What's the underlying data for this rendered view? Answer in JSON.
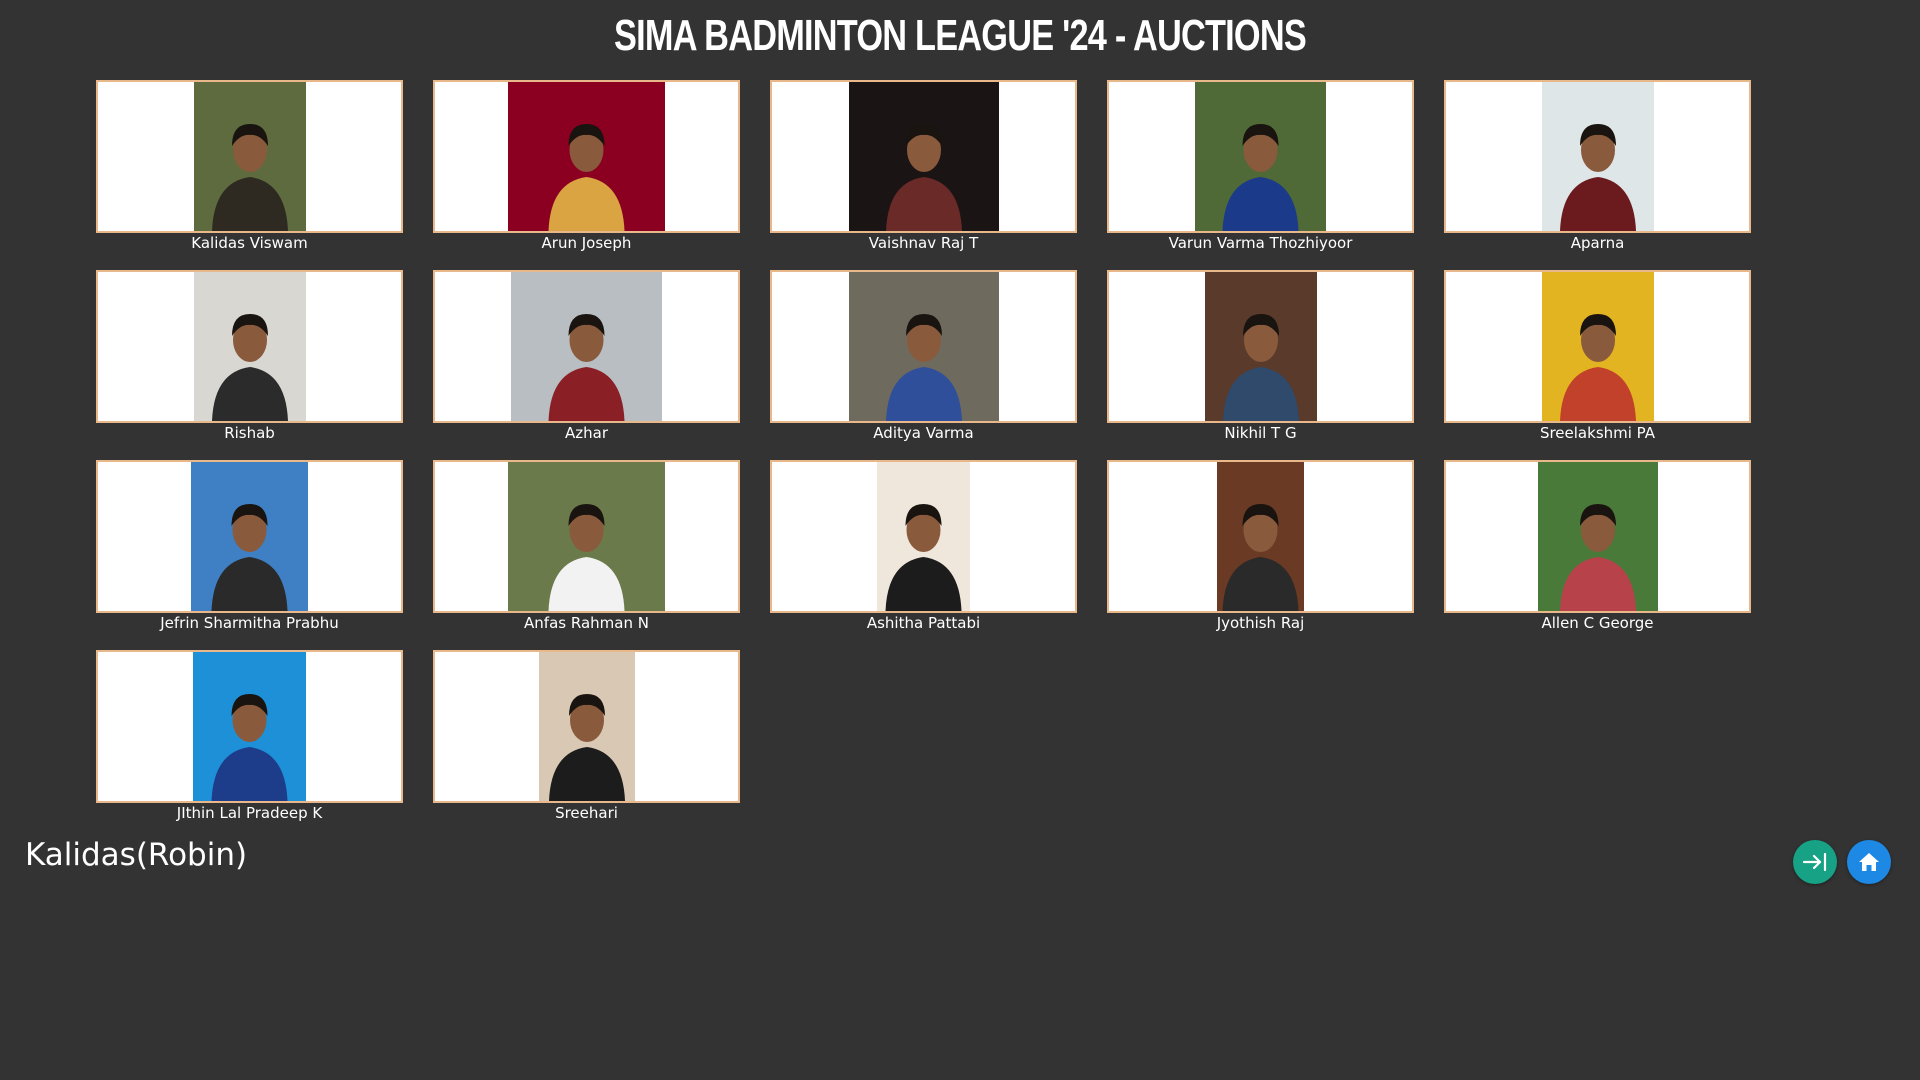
{
  "header": {
    "title": "SIMA BADMINTON LEAGUE '24 - AUCTIONS"
  },
  "players": [
    {
      "name": "Kalidas Viswam",
      "photo_bg": "#5d6b3e",
      "accent": "#2e2a22"
    },
    {
      "name": "Arun Joseph",
      "photo_bg": "#8b0020",
      "accent": "#d9a441"
    },
    {
      "name": "Vaishnav Raj T",
      "photo_bg": "#1a1414",
      "accent": "#6a2a28"
    },
    {
      "name": "Varun Varma Thozhiyoor",
      "photo_bg": "#4f6a36",
      "accent": "#1c3a8a"
    },
    {
      "name": "Aparna",
      "photo_bg": "#dfe6e8",
      "accent": "#6b1a1e"
    },
    {
      "name": "Rishab",
      "photo_bg": "#d9d7d2",
      "accent": "#2b2b2b"
    },
    {
      "name": "Azhar",
      "photo_bg": "#b8bec2",
      "accent": "#8a2026"
    },
    {
      "name": "Aditya Varma",
      "photo_bg": "#6e6a5e",
      "accent": "#2f4f9a"
    },
    {
      "name": "Nikhil T G",
      "photo_bg": "#5a3a2a",
      "accent": "#2f4a6a"
    },
    {
      "name": "Sreelakshmi PA",
      "photo_bg": "#e3b422",
      "accent": "#c2412a"
    },
    {
      "name": "Jefrin Sharmitha Prabhu",
      "photo_bg": "#3f7fc4",
      "accent": "#2a2a2a"
    },
    {
      "name": "Anfas Rahman N",
      "photo_bg": "#6b7a4a",
      "accent": "#f2f2f2"
    },
    {
      "name": "Ashitha Pattabi",
      "photo_bg": "#efe7dc",
      "accent": "#1c1c1c"
    },
    {
      "name": "Jyothish Raj",
      "photo_bg": "#6a3a24",
      "accent": "#2a2a2a"
    },
    {
      "name": "Allen C George",
      "photo_bg": "#4a7a3a",
      "accent": "#b8424a"
    },
    {
      "name": "JIthin Lal Pradeep K",
      "photo_bg": "#1e90d8",
      "accent": "#1d3d8a"
    },
    {
      "name": "Sreehari",
      "photo_bg": "#d9c9b4",
      "accent": "#1c1c1c"
    }
  ],
  "current_player": "Kalidas(Robin)",
  "controls": {
    "next_icon": "arrow-right-to-bar-icon",
    "home_icon": "home-icon"
  },
  "colors": {
    "background": "#333333",
    "card_border": "#e8b88a",
    "next_button": "#17a185",
    "home_button": "#1e88e5"
  }
}
